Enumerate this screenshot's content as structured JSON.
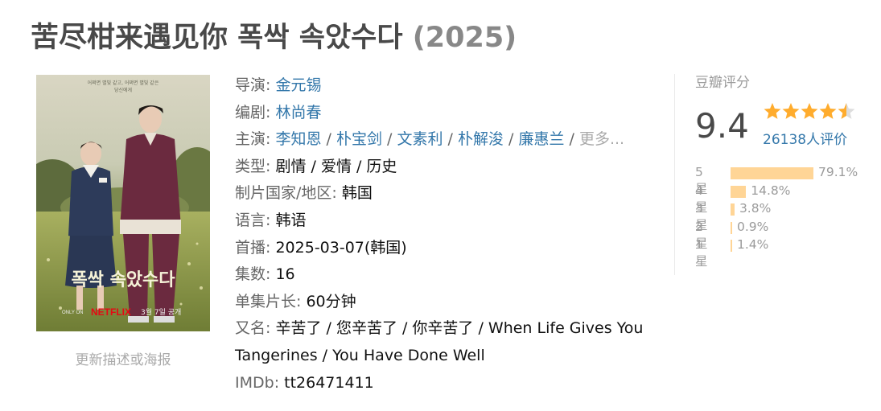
{
  "title": {
    "name": "苦尽柑来遇见你 폭싹 속았수다",
    "year": "(2025)"
  },
  "poster": {
    "tagline": "어쩌면 별빛 같고, 어쩌면 별빛 같은 당신에게",
    "korean_title": "폭싹 속았수다",
    "brand": "NETFLIX",
    "only_on": "ONLY ON",
    "release": "3월 7일 공개"
  },
  "update_link": "更新描述或海报",
  "info": {
    "director_label": "导演",
    "director": "金元锡",
    "writer_label": "编剧",
    "writer": "林尚春",
    "cast_label": "主演",
    "cast": [
      "李知恩",
      "朴宝剑",
      "文素利",
      "朴解浚",
      "廉惠兰"
    ],
    "cast_more": "更多...",
    "genre_label": "类型",
    "genres": "剧情 / 爱情 / 历史",
    "country_label": "制片国家/地区",
    "country": "韩国",
    "language_label": "语言",
    "language": "韩语",
    "premiere_label": "首播",
    "premiere": "2025-03-07(韩国)",
    "episodes_label": "集数",
    "episodes": "16",
    "runtime_label": "单集片长",
    "runtime": "60分钟",
    "aka_label": "又名",
    "aka": "辛苦了 / 您辛苦了 / 你辛苦了 / When Life Gives You Tangerines / You Have Done Well",
    "imdb_label": "IMDb",
    "imdb": "tt26471411"
  },
  "rating": {
    "label": "豆瓣评分",
    "score": "9.4",
    "stars": 4.5,
    "votes": "26138人评价",
    "distribution": [
      {
        "label": "5星",
        "percent": 79.1,
        "text": "79.1%"
      },
      {
        "label": "4星",
        "percent": 14.8,
        "text": "14.8%"
      },
      {
        "label": "3星",
        "percent": 3.8,
        "text": "3.8%"
      },
      {
        "label": "2星",
        "percent": 0.9,
        "text": "0.9%"
      },
      {
        "label": "1星",
        "percent": 1.4,
        "text": "1.4%"
      }
    ],
    "star_color": "#ffac2d",
    "bar_color": "#ffd596"
  }
}
